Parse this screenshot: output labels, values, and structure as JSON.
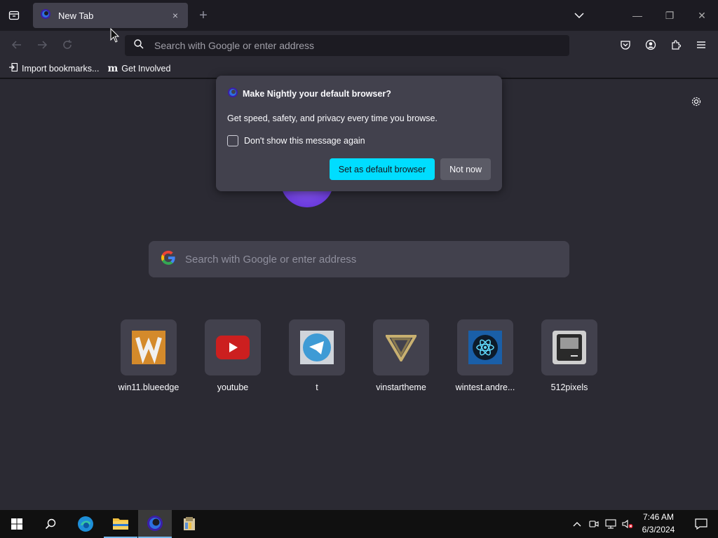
{
  "tab": {
    "title": "New Tab",
    "close": "×"
  },
  "newtab_button": "+",
  "window_controls": {
    "minimize": "—",
    "restore": "❐",
    "close": "✕"
  },
  "urlbar": {
    "placeholder": "Search with Google or enter address"
  },
  "bookmarks": [
    {
      "label": "Import bookmarks...",
      "icon": "import-icon"
    },
    {
      "label": "Get Involved",
      "icon": "mdn-icon"
    }
  ],
  "bookmark_icon_text": "m",
  "content_search": {
    "placeholder": "Search with Google or enter address",
    "icon": "google-icon"
  },
  "top_sites": [
    {
      "name": "win11.blueedge",
      "color": "#d48a2b"
    },
    {
      "name": "youtube",
      "color": "#cc1f1f"
    },
    {
      "name": "t",
      "color": "#3e9bd5"
    },
    {
      "name": "vinstartheme",
      "color": "#c8b070"
    },
    {
      "name": "wintest.andre...",
      "color": "#1a5fa8"
    },
    {
      "name": "512pixels",
      "color": "#cfcfcf"
    }
  ],
  "popup": {
    "title": "Make Nightly your default browser?",
    "message": "Get speed, safety, and privacy every time you browse.",
    "checkbox_label": "Don't show this message again",
    "primary_button": "Set as default browser",
    "secondary_button": "Not now"
  },
  "taskbar": {
    "time": "7:46 AM",
    "date": "6/3/2024"
  },
  "colors": {
    "accent": "#00ddff",
    "surface": "#42414d",
    "background": "#2b2a33"
  }
}
